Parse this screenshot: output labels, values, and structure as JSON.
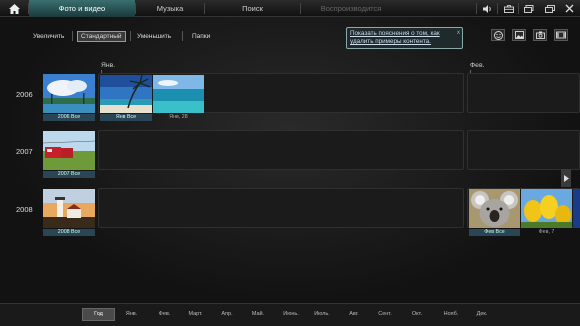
{
  "nav": {
    "tabs": [
      {
        "label": "Фото и видео",
        "state": "active"
      },
      {
        "label": "Музыка",
        "state": "normal"
      },
      {
        "label": "Поиск",
        "state": "normal"
      },
      {
        "label": "Воспроизводится",
        "state": "disabled"
      }
    ],
    "icons": [
      "home-icon",
      "volume-icon",
      "toolbox-icon",
      "restore-icon",
      "maximize-icon",
      "close-icon"
    ]
  },
  "views": {
    "zoom_in": "Увеличить",
    "standard": "Стандартный",
    "zoom_out": "Уменьшить",
    "folders": "Папки"
  },
  "tip": {
    "text": "Показать пояснения о том, как удалить примеры контента.",
    "close": "x"
  },
  "right_icons": [
    "smiley-icon",
    "picture-icon",
    "camera-icon",
    "film-icon"
  ],
  "timeline": {
    "month_labels": [
      "Янв.",
      "Фев."
    ],
    "rows": [
      {
        "year": "2006",
        "captions": [
          "2006 Все",
          "Янв Все",
          "Янв, 28"
        ]
      },
      {
        "year": "2007",
        "captions": [
          "2007 Все"
        ]
      },
      {
        "year": "2008",
        "captions": [
          "2008 Все",
          "Фев Все",
          "Фев, 7"
        ]
      }
    ]
  },
  "bottom": {
    "items": [
      {
        "label": "Год",
        "active": true
      },
      {
        "label": "Янв.",
        "active": false
      },
      {
        "label": "Фев.",
        "active": false
      },
      {
        "label": "Март.",
        "active": false
      },
      {
        "label": "Апр.",
        "active": false
      },
      {
        "label": "Май.",
        "active": false
      },
      {
        "label": "Июнь.",
        "active": false
      },
      {
        "label": "Июль.",
        "active": false
      },
      {
        "label": "Авг.",
        "active": false
      },
      {
        "label": "Сент.",
        "active": false
      },
      {
        "label": "Окт.",
        "active": false
      },
      {
        "label": "Нояб.",
        "active": false
      },
      {
        "label": "Дек.",
        "active": false
      }
    ]
  },
  "colors": {
    "accent": "#3a6f70",
    "caption_highlight": "#2a4656",
    "background": "#141414"
  }
}
